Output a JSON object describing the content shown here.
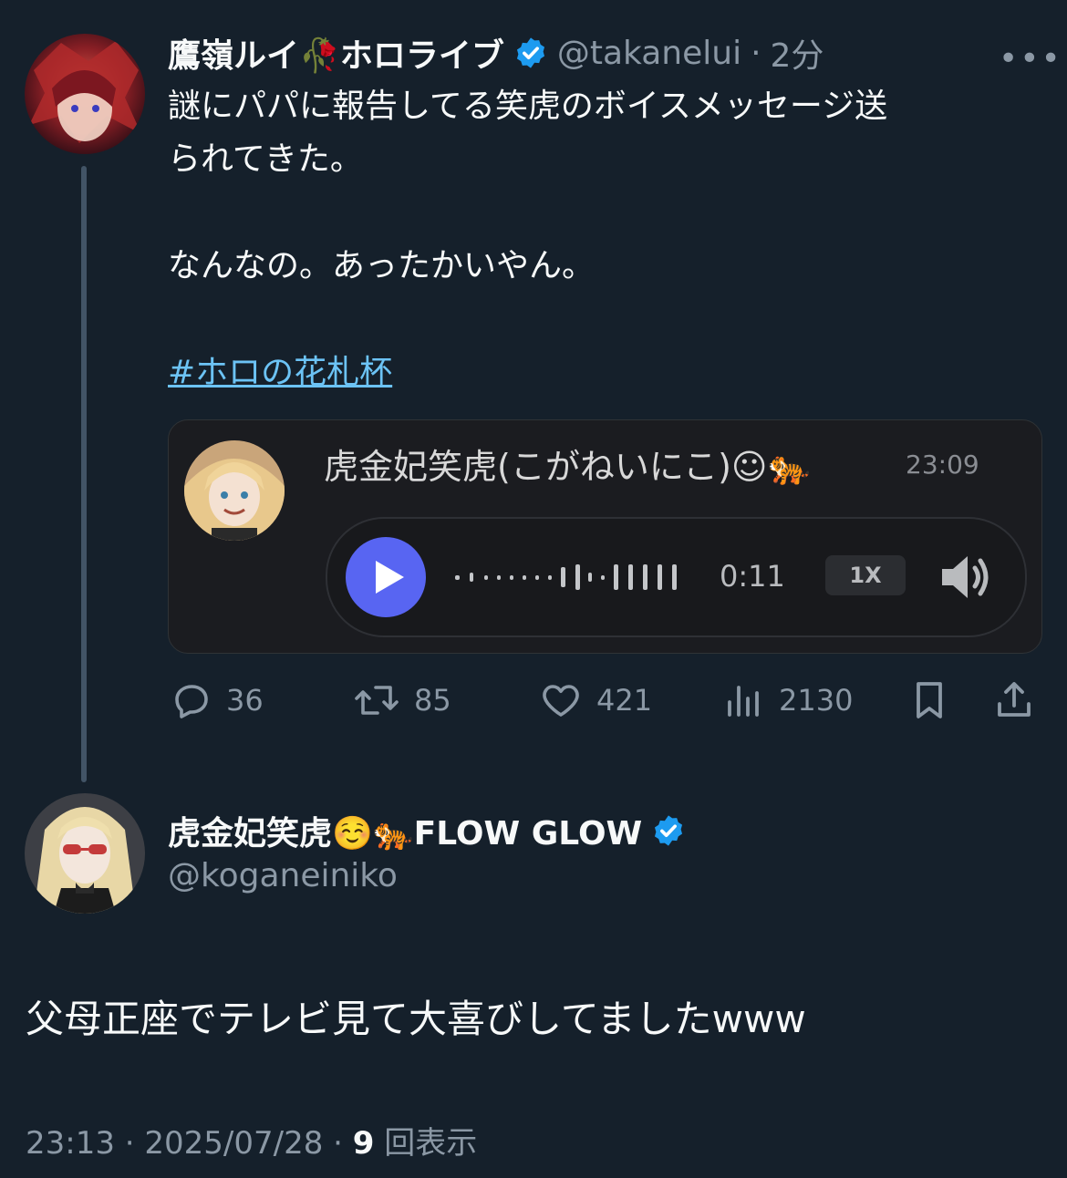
{
  "original_tweet": {
    "author_name": "鷹嶺ルイ🥀ホロライブ",
    "handle": "@takanelui",
    "separator": "·",
    "time_ago": "2分",
    "more_label": "•••",
    "text_line1": "謎にパパに報告してる笑虎のボイスメッセージ送",
    "text_line2": "られてきた。",
    "text_line3": "なんなの。あったかいやん。",
    "hashtag": "#ホロの花札杯",
    "media_card": {
      "sender": "虎金妃笑虎(こがねいにこ)☺🐅",
      "time": "23:09",
      "duration": "0:11",
      "speed": "1X"
    },
    "actions": {
      "replies": "36",
      "retweets": "85",
      "likes": "421",
      "views": "2130"
    }
  },
  "reply_tweet": {
    "author_name": "虎金妃笑虎☺️🐅FLOW GLOW",
    "handle": "@koganeiniko",
    "text": "父母正座でテレビ見て大喜びしてましたwww",
    "meta_time": "23:13 · 2025/07/28 · ",
    "meta_views_count": "9",
    "meta_views_label": " 回表示"
  },
  "colors": {
    "background": "#15202b",
    "verified": "#1d9bf0",
    "hashtag": "#6cc3f5",
    "play_button": "#5865f2"
  }
}
